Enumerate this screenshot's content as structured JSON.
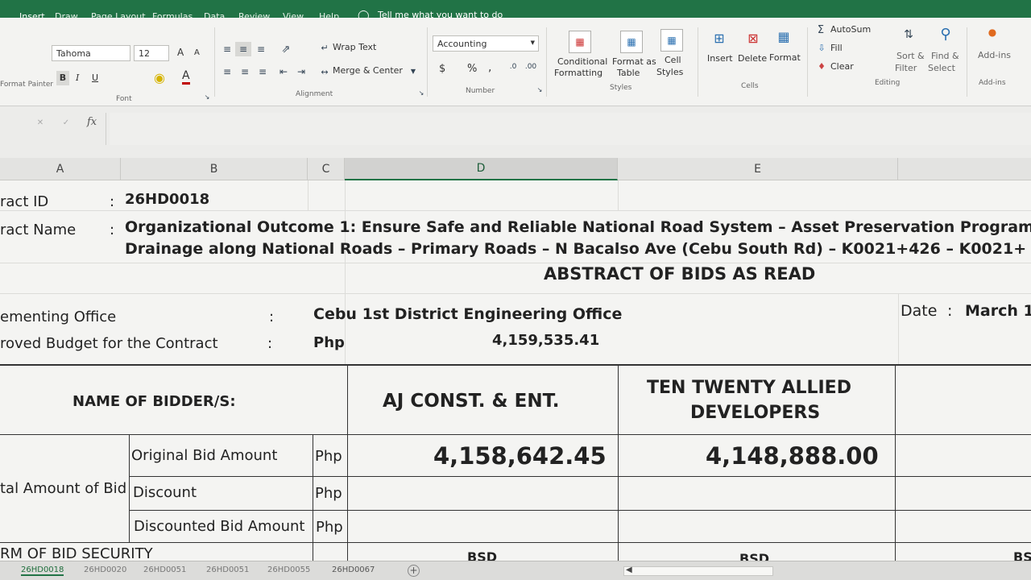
{
  "ribbon_tabs": [
    "Insert",
    "Draw",
    "Page Layout",
    "Formulas",
    "Data",
    "Review",
    "View",
    "Help"
  ],
  "tell_me": "Tell me what you want to do",
  "font": {
    "name": "Tahoma",
    "size": "12",
    "bold": "B",
    "italic": "I",
    "underline": "U",
    "font_color": "A",
    "grow": "A",
    "shrink": "A",
    "group_label": "Font",
    "format_painter": "Format Painter"
  },
  "alignment": {
    "wrap_text": "Wrap Text",
    "merge_center": "Merge & Center",
    "group_label": "Alignment"
  },
  "number": {
    "format": "Accounting",
    "currency": "$",
    "percent": "%",
    "comma": ",",
    "group_label": "Number"
  },
  "styles": {
    "conditional_1": "Conditional",
    "conditional_2": "Formatting",
    "format_table_1": "Format as",
    "format_table_2": "Table",
    "cell_styles_1": "Cell",
    "cell_styles_2": "Styles",
    "group_label": "Styles"
  },
  "cells": {
    "insert": "Insert",
    "delete": "Delete",
    "format": "Format",
    "group_label": "Cells"
  },
  "editing": {
    "autosum": "AutoSum",
    "fill": "Fill",
    "clear": "Clear",
    "sort_1": "Sort &",
    "sort_2": "Filter",
    "find_1": "Find &",
    "find_2": "Select",
    "group_label": "Editing"
  },
  "addins": {
    "label": "Add-ins",
    "group_label": "Add-ins"
  },
  "formula_bar": {
    "fx": "fx"
  },
  "columns": [
    "A",
    "B",
    "C",
    "D",
    "E"
  ],
  "sheet": {
    "contract_id_label": "ract ID",
    "contract_id_value": "26HD0018",
    "contract_name_label": "ract Name",
    "colon": ":",
    "contract_name_line1": "Organizational Outcome 1:  Ensure Safe and Reliable National Road System – Asset Preservation Program",
    "contract_name_line2": "Drainage along National Roads – Primary Roads – N Bacalso Ave (Cebu South Rd) – K0021+426 – K0021+",
    "abstract_title": "ABSTRACT OF BIDS AS READ",
    "implementing_office_label": "ementing Office",
    "implementing_office_value": "Cebu 1st District Engineering Office",
    "date_label": "Date",
    "date_value": "March 1",
    "budget_label": "roved Budget for the Contract",
    "budget_currency": "Php",
    "budget_value": "4,159,535.41",
    "bidders_label": "NAME OF BIDDER/S:",
    "bidder1": "AJ CONST. & ENT.",
    "bidder2_line1": "TEN TWENTY ALLIED",
    "bidder2_line2": "DEVELOPERS",
    "total_amount_label": "tal Amount of Bid",
    "original_bid_label": "Original Bid Amount",
    "discount_label": "Discount",
    "discounted_label": "Discounted Bid Amount",
    "currency": "Php",
    "bid1_amount": "4,158,642.45",
    "bid2_amount": "4,148,888.00",
    "bid_security_label": "RM OF BID SECURITY",
    "bsd1": "BSD",
    "bsd2": "BSD",
    "bsd3": "BS"
  },
  "sheet_tabs": [
    "26HD0018",
    "26HD0020",
    "26HD0051",
    "26HD0051",
    "26HD0055",
    "26HD0067"
  ]
}
